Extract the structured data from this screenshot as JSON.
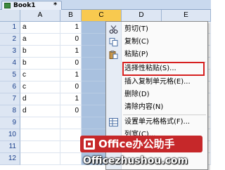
{
  "tab": {
    "title": "Book1",
    "modified_marker": "*"
  },
  "columns": [
    "A",
    "B",
    "C",
    "D",
    "E"
  ],
  "selected_column": "C",
  "rows": [
    {
      "num": "1",
      "a": "a",
      "b": "1"
    },
    {
      "num": "2",
      "a": "a",
      "b": "0"
    },
    {
      "num": "3",
      "a": "b",
      "b": "1"
    },
    {
      "num": "4",
      "a": "b",
      "b": "0"
    },
    {
      "num": "5",
      "a": "c",
      "b": "1"
    },
    {
      "num": "6",
      "a": "c",
      "b": "0"
    },
    {
      "num": "7",
      "a": "d",
      "b": "1"
    },
    {
      "num": "8",
      "a": "d",
      "b": "0"
    },
    {
      "num": "9",
      "a": "",
      "b": ""
    },
    {
      "num": "10",
      "a": "",
      "b": ""
    },
    {
      "num": "11",
      "a": "",
      "b": ""
    },
    {
      "num": "12",
      "a": "",
      "b": ""
    }
  ],
  "context_menu": {
    "items": [
      {
        "label": "剪切(T)",
        "icon": "scissors-icon"
      },
      {
        "label": "复制(C)",
        "icon": "copy-icon"
      },
      {
        "label": "粘贴(P)",
        "icon": "paste-icon"
      },
      {
        "label": "选择性粘贴(S)...",
        "icon": "",
        "highlighted": true
      },
      {
        "label": "插入复制单元格(E)...",
        "icon": ""
      },
      {
        "label": "删除(D)",
        "icon": ""
      },
      {
        "label": "清除内容(N)",
        "icon": ""
      },
      {
        "label": "设置单元格格式(F)...",
        "icon": "format-cells-icon"
      },
      {
        "label": "列宽(C)...",
        "icon": ""
      }
    ],
    "highlight_color": "#d62020"
  },
  "watermark": {
    "brand": "Office办公助手",
    "url": "Officezhushou.com",
    "color": "#c6282a"
  }
}
